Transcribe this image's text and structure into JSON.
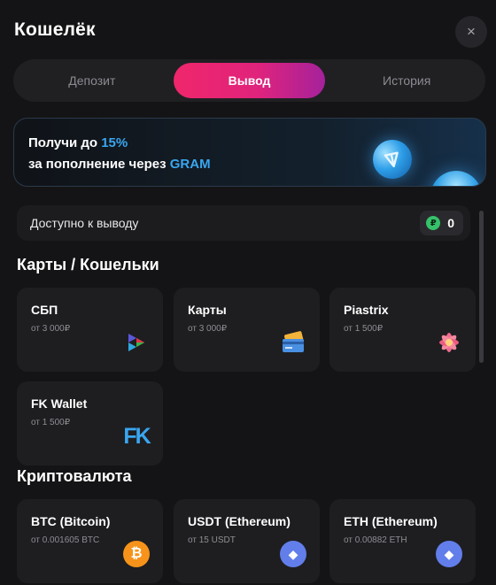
{
  "header": {
    "title": "Кошелёк",
    "close_icon": "×"
  },
  "tabs": [
    {
      "label": "Депозит",
      "active": false
    },
    {
      "label": "Вывод",
      "active": true
    },
    {
      "label": "История",
      "active": false
    }
  ],
  "promo": {
    "line1_text": "Получи до ",
    "line1_highlight": "15%",
    "line2_text": "за пополнение через ",
    "line2_highlight": "GRAM",
    "highlight_color": "#3aa6f0"
  },
  "available": {
    "label": "Доступно к выводу",
    "currency_symbol": "₽",
    "amount": "0"
  },
  "sections": {
    "cards": "Карты / Кошельки",
    "crypto": "Криптовалюта"
  },
  "methods": [
    {
      "name": "СБП",
      "min": "от 3 000₽",
      "icon": "sbp-icon"
    },
    {
      "name": "Карты",
      "min": "от 3 000₽",
      "icon": "bank-card-icon"
    },
    {
      "name": "Piastrix",
      "min": "от 1 500₽",
      "icon": "piastrix-flower-icon"
    },
    {
      "name": "FK Wallet",
      "min": "от 1 500₽",
      "icon": "fk-wallet-icon",
      "icon_text": "FK"
    }
  ],
  "crypto": [
    {
      "name": "BTC (Bitcoin)",
      "min": "от 0.001605 BTC",
      "icon": "bitcoin-icon",
      "icon_text": "₿",
      "color": "#f7931a"
    },
    {
      "name": "USDT (Ethereum)",
      "min": "от 15 USDT",
      "icon": "ethereum-icon",
      "icon_text": "◆",
      "color": "#627eea"
    },
    {
      "name": "ETH (Ethereum)",
      "min": "от 0.00882 ETH",
      "icon": "ethereum-icon",
      "icon_text": "◆",
      "color": "#627eea"
    }
  ],
  "colors": {
    "accent_gradient_start": "#f0266b",
    "accent_gradient_end": "#a5229b",
    "background": "#141416",
    "card": "#1e1e21"
  }
}
